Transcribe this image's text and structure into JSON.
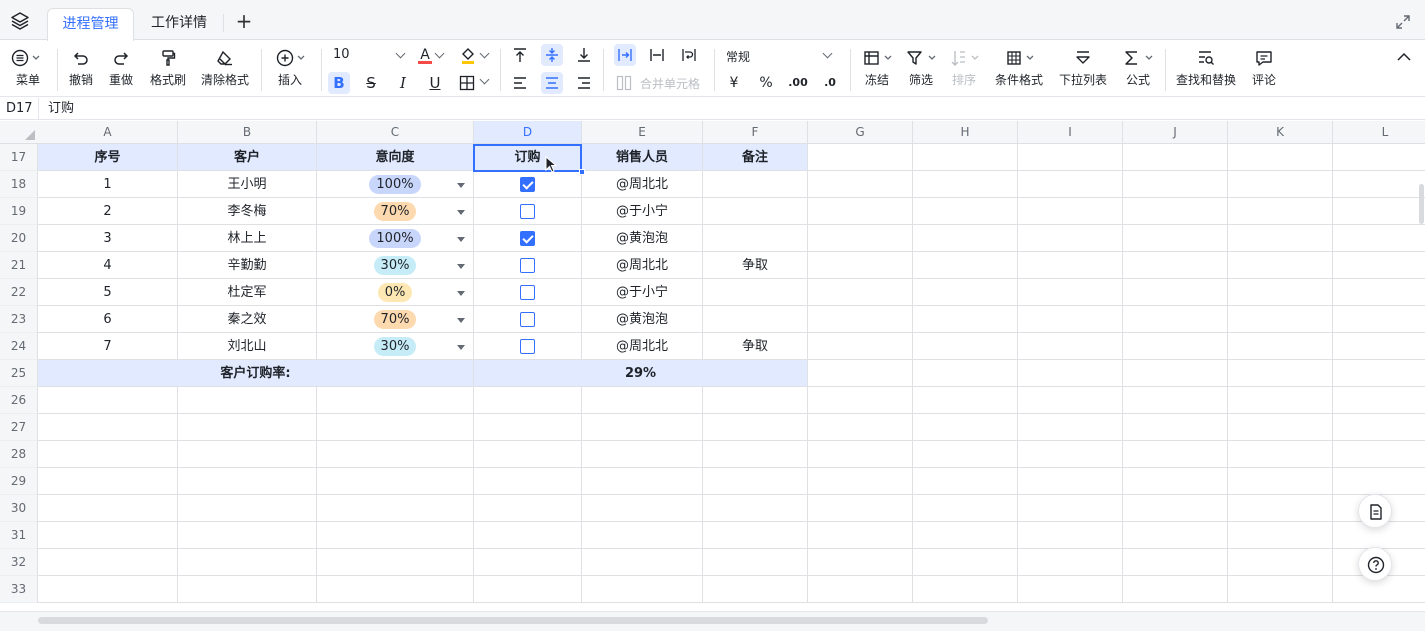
{
  "tabs": [
    {
      "label": "进程管理",
      "active": true
    },
    {
      "label": "工作详情",
      "active": false
    }
  ],
  "toolbar": {
    "menu": "菜单",
    "undo": "撤销",
    "redo": "重做",
    "format_painter": "格式刷",
    "clear_format": "清除格式",
    "insert": "插入",
    "font_size": "10",
    "merge_cells": "合并单元格",
    "number_format": "常规",
    "freeze": "冻结",
    "filter": "筛选",
    "sort": "排序",
    "conditional_format": "条件格式",
    "dropdown_list": "下拉列表",
    "formula": "公式",
    "find_replace": "查找和替换",
    "comment": "评论",
    "bold": "B",
    "strike": "S",
    "italic": "I",
    "underline": "U",
    "currency": "¥",
    "percent": "%",
    "dec_increase": ".00",
    "dec_decrease": ".0"
  },
  "formula_bar": {
    "cell_ref": "D17",
    "value": "订购"
  },
  "columns": [
    "A",
    "B",
    "C",
    "D",
    "E",
    "F",
    "G",
    "H",
    "I",
    "J",
    "K",
    "L"
  ],
  "selected_column": "D",
  "row_numbers": [
    "17",
    "18",
    "19",
    "20",
    "21",
    "22",
    "23",
    "24",
    "25",
    "26",
    "27",
    "28",
    "29",
    "30",
    "31",
    "32",
    "33"
  ],
  "table": {
    "headers": [
      "序号",
      "客户",
      "意向度",
      "订购",
      "销售人员",
      "备注"
    ],
    "rows": [
      {
        "no": "1",
        "customer": "王小明",
        "intent": "100%",
        "intent_color": "#c9d6fb",
        "ordered": true,
        "sales": "@周北北",
        "note": ""
      },
      {
        "no": "2",
        "customer": "李冬梅",
        "intent": "70%",
        "intent_color": "#fcd9ae",
        "ordered": false,
        "sales": "@于小宁",
        "note": ""
      },
      {
        "no": "3",
        "customer": "林上上",
        "intent": "100%",
        "intent_color": "#c9d6fb",
        "ordered": true,
        "sales": "@黄泡泡",
        "note": ""
      },
      {
        "no": "4",
        "customer": "辛勤勤",
        "intent": "30%",
        "intent_color": "#c6ecf7",
        "ordered": false,
        "sales": "@周北北",
        "note": "争取"
      },
      {
        "no": "5",
        "customer": "杜定军",
        "intent": "0%",
        "intent_color": "#fde8b3",
        "ordered": false,
        "sales": "@于小宁",
        "note": ""
      },
      {
        "no": "6",
        "customer": "秦之效",
        "intent": "70%",
        "intent_color": "#fcd9ae",
        "ordered": false,
        "sales": "@黄泡泡",
        "note": ""
      },
      {
        "no": "7",
        "customer": "刘北山",
        "intent": "30%",
        "intent_color": "#c6ecf7",
        "ordered": false,
        "sales": "@周北北",
        "note": "争取"
      }
    ],
    "summary_label": "客户订购率:",
    "summary_value": "29%"
  },
  "colors": {
    "accent": "#3370ff",
    "header_fill": "#e1eaff"
  }
}
